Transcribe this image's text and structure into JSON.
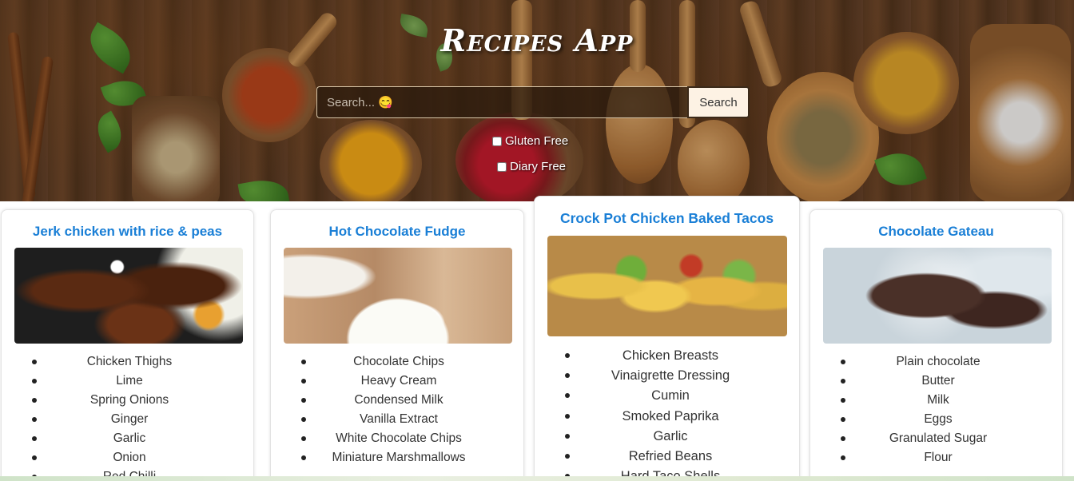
{
  "header": {
    "title": "Recipes App",
    "search": {
      "placeholder": "Search... 😋",
      "value": "",
      "button_label": "Search"
    },
    "filters": [
      {
        "label": "Gluten Free",
        "checked": false
      },
      {
        "label": "Diary Free",
        "checked": false
      }
    ]
  },
  "recipes": [
    {
      "title": "Jerk chicken with rice & peas",
      "image_subject": "grilled jerk chicken",
      "ingredients": [
        "Chicken Thighs",
        "Lime",
        "Spring Onions",
        "Ginger",
        "Garlic",
        "Onion",
        "Red Chilli"
      ]
    },
    {
      "title": "Hot Chocolate Fudge",
      "image_subject": "fudge with marshmallows",
      "ingredients": [
        "Chocolate Chips",
        "Heavy Cream",
        "Condensed Milk",
        "Vanilla Extract",
        "White Chocolate Chips",
        "Miniature Marshmallows"
      ]
    },
    {
      "title": "Crock Pot Chicken Baked Tacos",
      "image_subject": "baked tacos",
      "ingredients": [
        "Chicken Breasts",
        "Vinaigrette Dressing",
        "Cumin",
        "Smoked Paprika",
        "Garlic",
        "Refried Beans",
        "Hard Taco Shells"
      ]
    },
    {
      "title": "Chocolate Gateau",
      "image_subject": "chocolate cake dusted with sugar",
      "ingredients": [
        "Plain chocolate",
        "Butter",
        "Milk",
        "Eggs",
        "Granulated Sugar",
        "Flour"
      ]
    }
  ],
  "colors": {
    "title_blue": "#1a7fd6",
    "hero_wood": "#5a3a22",
    "search_button_bg": "#fdf2e4"
  }
}
